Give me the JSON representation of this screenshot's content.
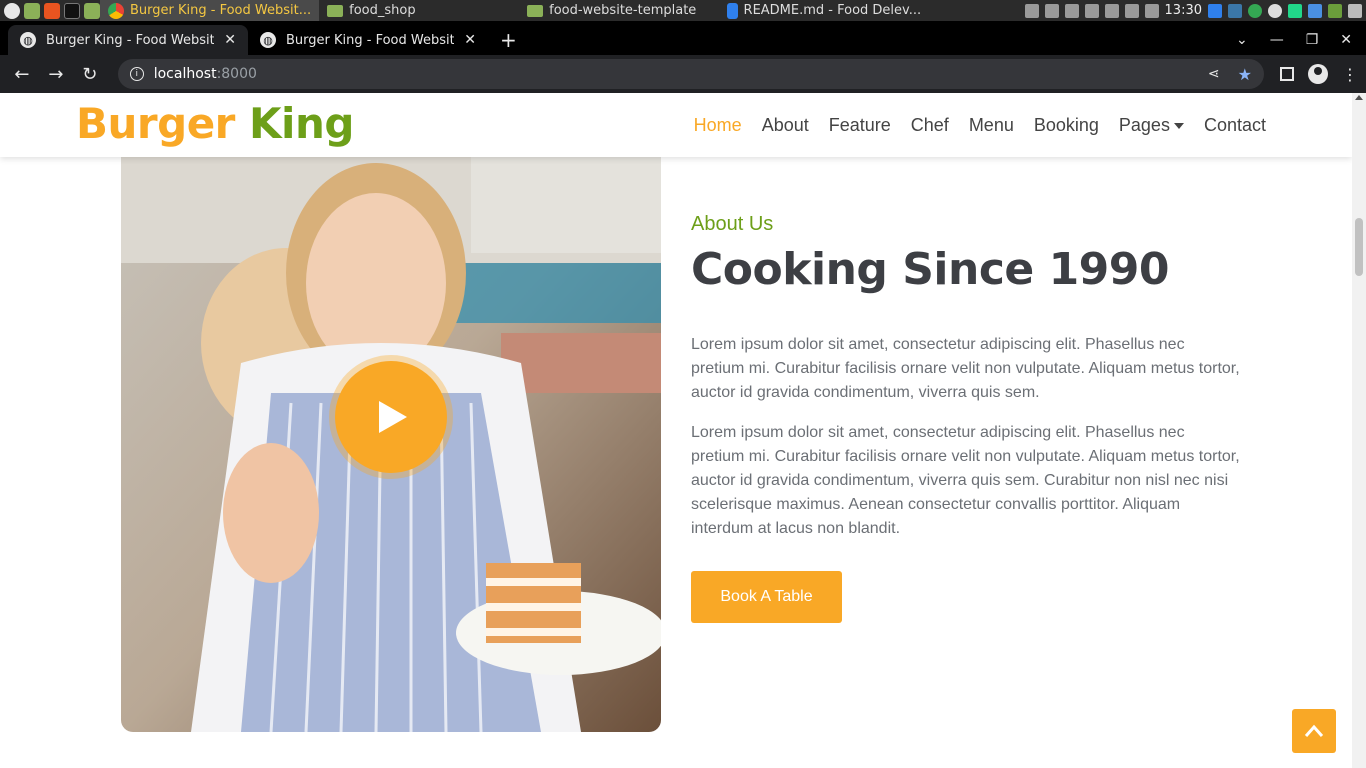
{
  "os_taskbar": {
    "tasks": [
      {
        "label": "Burger King - Food Websit...",
        "active": true
      },
      {
        "label": "food_shop",
        "active": false
      },
      {
        "label": "food-website-template",
        "active": false
      },
      {
        "label": "README.md - Food Delev...",
        "active": false
      }
    ],
    "clock": "13:30"
  },
  "browser": {
    "tabs": [
      {
        "title": "Burger King - Food Website Te",
        "active": true
      },
      {
        "title": "Burger King - Food Website Te",
        "active": false
      }
    ],
    "url_host": "localhost",
    "url_port": ":8000"
  },
  "site": {
    "brand_first": "Burger",
    "brand_second": "King",
    "nav": [
      "Home",
      "About",
      "Feature",
      "Chef",
      "Menu",
      "Booking",
      "Pages",
      "Contact"
    ],
    "active_nav": "Home"
  },
  "about": {
    "eyebrow": "About Us",
    "heading": "Cooking Since 1990",
    "paragraph_1": "Lorem ipsum dolor sit amet, consectetur adipiscing elit. Phasellus nec pretium mi. Curabitur facilisis ornare velit non vulputate. Aliquam metus tortor, auctor id gravida condimentum, viverra quis sem.",
    "paragraph_2": "Lorem ipsum dolor sit amet, consectetur adipiscing elit. Phasellus nec pretium mi. Curabitur facilisis ornare velit non vulputate. Aliquam metus tortor, auctor id gravida condimentum, viverra quis sem. Curabitur non nisl nec nisi scelerisque maximus. Aenean consectetur convallis porttitor. Aliquam interdum at lacus non blandit.",
    "button": "Book A Table"
  },
  "colors": {
    "accent_orange": "#f9a826",
    "accent_green": "#6d9f19",
    "heading": "#3d3f44",
    "body_text": "#6b6f75"
  },
  "icons": {
    "play": "play-icon",
    "back_to_top": "chevron-up-icon"
  }
}
